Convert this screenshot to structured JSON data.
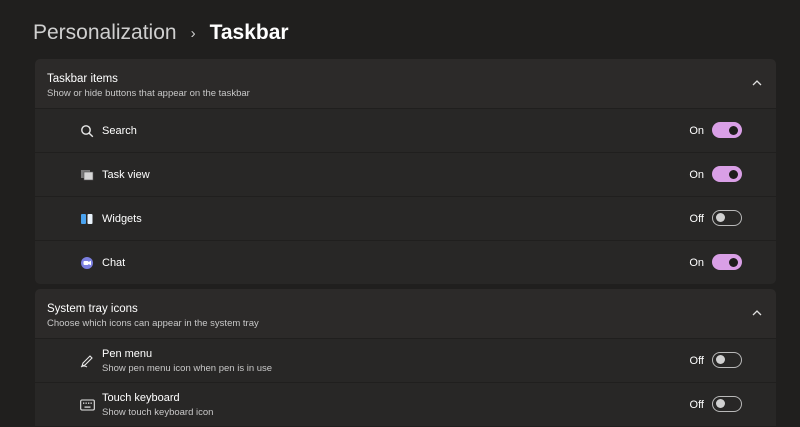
{
  "breadcrumb": {
    "parent": "Personalization",
    "separator": "›",
    "current": "Taskbar"
  },
  "taskbar_items": {
    "title": "Taskbar items",
    "subtitle": "Show or hide buttons that appear on the taskbar",
    "items": [
      {
        "label": "Search",
        "state": "On",
        "icon": "search-icon"
      },
      {
        "label": "Task view",
        "state": "On",
        "icon": "task-view-icon"
      },
      {
        "label": "Widgets",
        "state": "Off",
        "icon": "widgets-icon"
      },
      {
        "label": "Chat",
        "state": "On",
        "icon": "chat-icon"
      }
    ]
  },
  "system_tray": {
    "title": "System tray icons",
    "subtitle": "Choose which icons can appear in the system tray",
    "items": [
      {
        "label": "Pen menu",
        "description": "Show pen menu icon when pen is in use",
        "state": "Off",
        "icon": "pen-icon"
      },
      {
        "label": "Touch keyboard",
        "description": "Show touch keyboard icon",
        "state": "Off",
        "icon": "keyboard-icon"
      }
    ]
  },
  "colors": {
    "accent": "#d99fe6",
    "background": "#201f1e",
    "card": "#2c2a29"
  }
}
